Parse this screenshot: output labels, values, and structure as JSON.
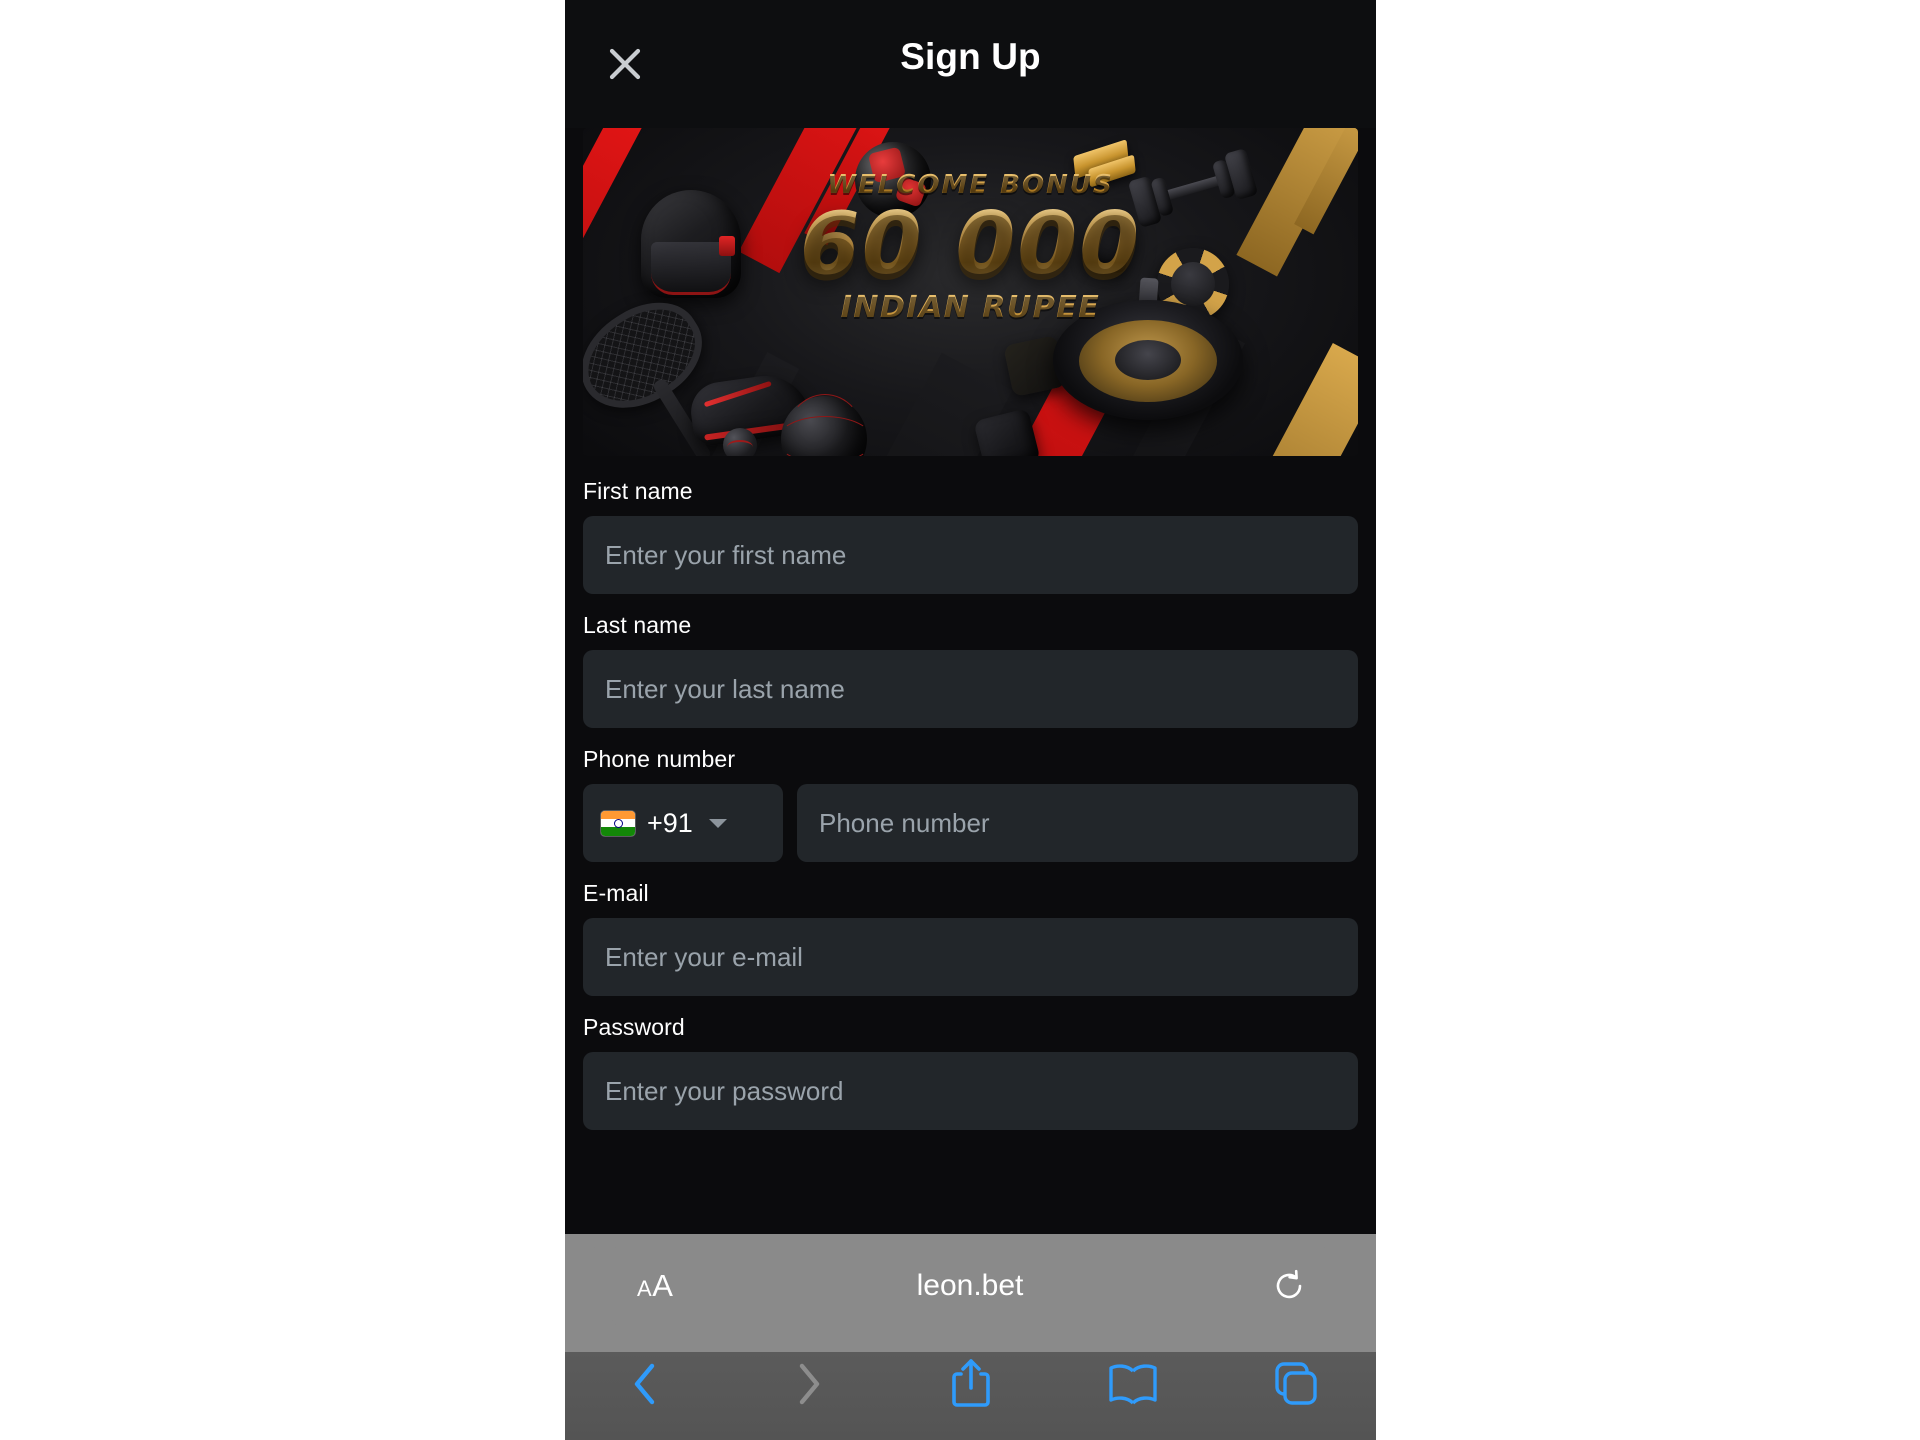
{
  "modal": {
    "title": "Sign Up",
    "close_icon": "close-icon"
  },
  "banner": {
    "headline": "WELCOME BONUS",
    "amount": "60 000",
    "currency": "INDIAN RUPEE",
    "accent_gold": "#d2a04c",
    "accent_red": "#e11515"
  },
  "form": {
    "fields": [
      {
        "label": "First name",
        "placeholder": "Enter your first name",
        "value": ""
      },
      {
        "label": "Last name",
        "placeholder": "Enter your last name",
        "value": ""
      }
    ],
    "phone": {
      "label": "Phone number",
      "country_flag": "india-flag-icon",
      "country_code": "+91",
      "placeholder": "Phone number",
      "value": ""
    },
    "email": {
      "label": "E-mail",
      "placeholder": "Enter your e-mail",
      "value": ""
    },
    "password": {
      "label": "Password",
      "placeholder": "Enter your password",
      "value": ""
    }
  },
  "browser": {
    "text_size_label": "A",
    "text_size_label_big": "A",
    "url": "leon.bet",
    "reload_icon": "reload-icon",
    "toolbar": [
      {
        "name": "back-button",
        "icon": "chevron-left-icon",
        "enabled": true
      },
      {
        "name": "forward-button",
        "icon": "chevron-right-icon",
        "enabled": false
      },
      {
        "name": "share-button",
        "icon": "share-icon",
        "enabled": true
      },
      {
        "name": "bookmarks-button",
        "icon": "book-icon",
        "enabled": true
      },
      {
        "name": "tabs-button",
        "icon": "tabs-icon",
        "enabled": true
      }
    ]
  }
}
